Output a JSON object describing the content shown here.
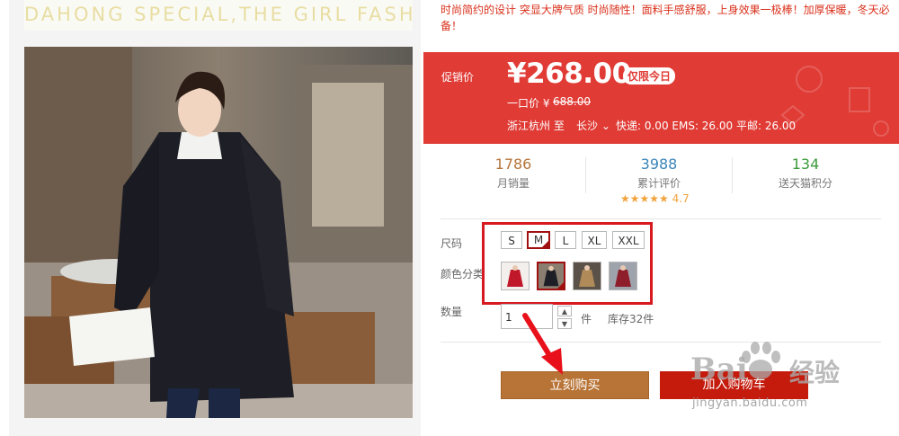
{
  "banner": {
    "text": "DAHONG SPECIAL,THE GIRL FASHIO"
  },
  "product": {
    "description": "时尚简约的设计 突显大牌气质 时尚随性！面料手感舒服，上身效果一极棒！加厚保暖，冬天必备！"
  },
  "price": {
    "label": "促销价",
    "value": "¥268.00",
    "badge": "仅限今日",
    "original_label": "一口价 ¥",
    "original_value": "688.00",
    "ship_from": "浙江杭州  至",
    "ship_to": "长沙",
    "ship_fee": "快递: 0.00 EMS: 26.00 平邮: 26.00"
  },
  "stats": [
    {
      "value": "1786",
      "label": "月销量",
      "color": "#b5743a"
    },
    {
      "value": "3988",
      "label": "累计评价",
      "color": "#3a85b8"
    },
    {
      "value": "134",
      "label": "送天猫积分",
      "color": "#3a9b3a"
    }
  ],
  "rating": {
    "stars": "★★★★★",
    "score": "4.7",
    "value": 4.7
  },
  "options": {
    "size_label": "尺码",
    "sizes": [
      "S",
      "M",
      "L",
      "XL",
      "XXL"
    ],
    "selected_size": "M",
    "color_label": "颜色分类",
    "selected_color_index": 1
  },
  "quantity": {
    "label": "数量",
    "value": "1",
    "unit": "件",
    "stock": "库存32件",
    "up": "▲",
    "down": "▼"
  },
  "buttons": {
    "buy": "立刻购买",
    "cart": "加入购物车"
  },
  "watermark": {
    "brand": "Bai",
    "text": "经验",
    "url": "jingyan.baidu.com"
  },
  "colors": {
    "price_bg": "#e03b35",
    "buy": "#b87336",
    "cart": "#c41b0c",
    "highlight": "#d71920"
  }
}
